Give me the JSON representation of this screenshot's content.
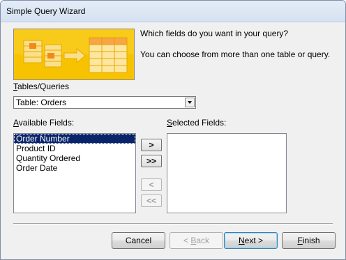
{
  "window": {
    "title": "Simple Query Wizard"
  },
  "prompt": {
    "question": "Which fields do you want in your query?",
    "hint": "You can choose from more than one table or query."
  },
  "tables": {
    "label_access": "T",
    "label_rest": "ables/Queries",
    "selected": "Table: Orders"
  },
  "available": {
    "label_access": "A",
    "label_rest": "vailable Fields:",
    "items": [
      "Order Number",
      "Product ID",
      "Quantity Ordered",
      "Order Date"
    ],
    "selected_index": 0
  },
  "selected_fields": {
    "label_access": "S",
    "label_rest": "elected Fields:",
    "items": []
  },
  "move_buttons": {
    "add_one": ">",
    "add_all": ">>",
    "remove_one": "<",
    "remove_all": "<<"
  },
  "footer": {
    "cancel": "Cancel",
    "back_prefix": "< ",
    "back_access": "B",
    "back_rest": "ack",
    "next_access": "N",
    "next_rest": "ext >",
    "finish_access": "F",
    "finish_rest": "inish"
  },
  "colors": {
    "banner_bg": "#f6c200",
    "selection": "#0a246a"
  }
}
